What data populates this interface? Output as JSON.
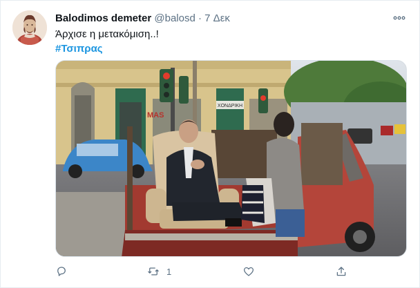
{
  "tweet": {
    "display_name": "Balodimos demeter",
    "handle": "@balosd",
    "separator": "·",
    "date": "7 Δεκ",
    "text": "Άρχισε η μετακόμιση..!",
    "hashtag": "#Τσιπρας",
    "media": {
      "shop_sign": "ΧΟΝΔΡΙΚΗ",
      "graffiti": "MAS"
    },
    "actions": {
      "reply_icon": "reply-icon",
      "retweet_icon": "retweet-icon",
      "retweet_count": "1",
      "like_icon": "like-icon",
      "share_icon": "share-icon"
    }
  },
  "colors": {
    "link": "#1b95e0",
    "muted": "#5b7083",
    "border": "#e6ecf0"
  }
}
